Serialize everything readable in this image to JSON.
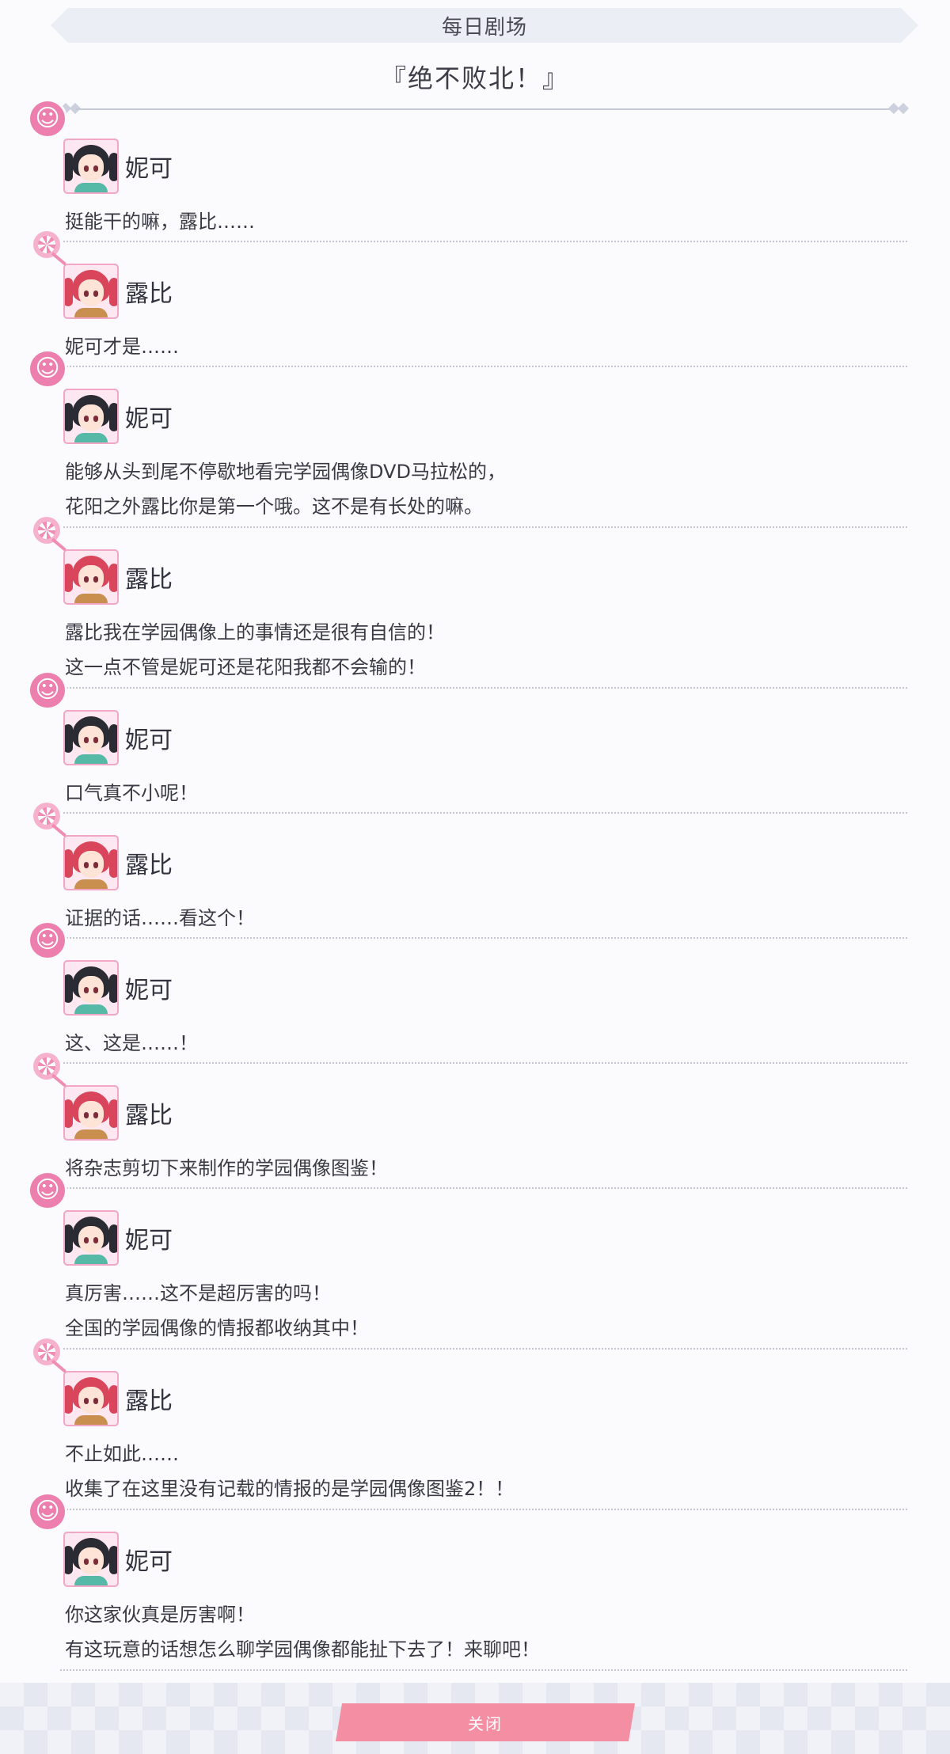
{
  "header": {
    "title": "每日剧场"
  },
  "episode": {
    "title": "『绝不败北！』"
  },
  "dialogue": [
    {
      "speaker": "妮可",
      "lines": [
        "挺能干的嘛，露比……"
      ]
    },
    {
      "speaker": "露比",
      "lines": [
        "妮可才是……"
      ]
    },
    {
      "speaker": "妮可",
      "lines": [
        "能够从头到尾不停歇地看完学园偶像DVD马拉松的，",
        "花阳之外露比你是第一个哦。这不是有长处的嘛。"
      ]
    },
    {
      "speaker": "露比",
      "lines": [
        "露比我在学园偶像上的事情还是很有自信的！",
        "这一点不管是妮可还是花阳我都不会输的！"
      ]
    },
    {
      "speaker": "妮可",
      "lines": [
        "口气真不小呢！"
      ]
    },
    {
      "speaker": "露比",
      "lines": [
        "证据的话……看这个！"
      ]
    },
    {
      "speaker": "妮可",
      "lines": [
        "这、这是……！"
      ]
    },
    {
      "speaker": "露比",
      "lines": [
        "将杂志剪切下来制作的学园偶像图鉴！"
      ]
    },
    {
      "speaker": "妮可",
      "lines": [
        "真厉害……这不是超厉害的吗！",
        "全国的学园偶像的情报都收纳其中！"
      ]
    },
    {
      "speaker": "露比",
      "lines": [
        "不止如此……",
        "收集了在这里没有记载的情报的是学园偶像图鉴2！！"
      ]
    },
    {
      "speaker": "妮可",
      "lines": [
        "你这家伙真是厉害啊！",
        "有这玩意的话想怎么聊学园偶像都能扯下去了！来聊吧！"
      ]
    }
  ],
  "footer": {
    "close_label": "关闭"
  }
}
